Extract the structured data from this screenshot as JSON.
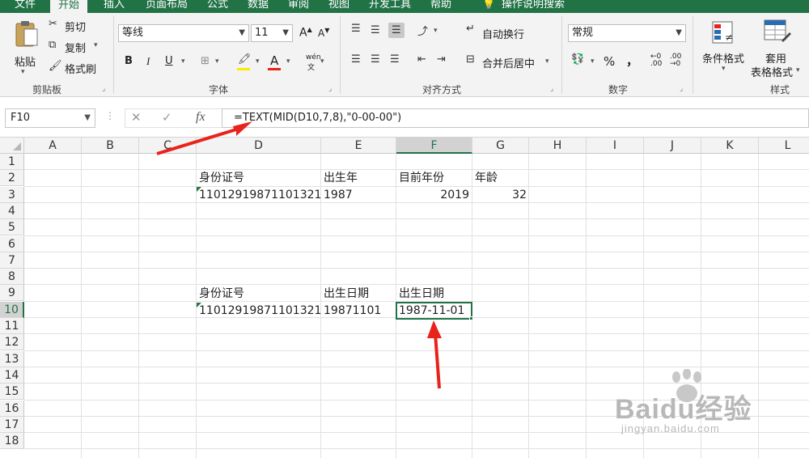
{
  "ribbon": {
    "tabs": [
      "文件",
      "开始",
      "插入",
      "页面布局",
      "公式",
      "数据",
      "审阅",
      "视图",
      "开发工具",
      "帮助",
      "操作说明搜索"
    ],
    "active_tab_index": 1,
    "clipboard": {
      "paste": "粘贴",
      "cut": "剪切",
      "copy": "复制",
      "format_painter": "格式刷",
      "label": "剪贴板"
    },
    "font": {
      "name": "等线",
      "size": "11",
      "grow": "A",
      "shrink": "A",
      "bold": "B",
      "italic": "I",
      "underline": "U",
      "color_letter": "A",
      "phonetic": "wén",
      "label": "字体"
    },
    "alignment": {
      "wrap_text": "自动换行",
      "merge_center": "合并后居中",
      "label": "对齐方式"
    },
    "number": {
      "format": "常规",
      "percent": "%",
      "comma": "，",
      "label": "数字"
    },
    "styles": {
      "conditional": "条件格式",
      "table_line1": "套用",
      "table_line2": "表格格式",
      "label": "样式"
    }
  },
  "formula_bar": {
    "name_box": "F10",
    "cancel": "✕",
    "enter": "✓",
    "fx": "fx",
    "formula": "=TEXT(MID(D10,7,8),\"0-00-00\")"
  },
  "sheet": {
    "columns": [
      "A",
      "B",
      "C",
      "D",
      "E",
      "F",
      "G",
      "H",
      "I",
      "J",
      "K",
      "L"
    ],
    "rows": [
      "1",
      "2",
      "3",
      "4",
      "5",
      "6",
      "7",
      "8",
      "9",
      "10",
      "11",
      "12",
      "13",
      "14",
      "15",
      "16",
      "17",
      "18"
    ],
    "selected_column": "F",
    "selected_row": "10",
    "cells": {
      "D2": "身份证号",
      "E2": "出生年",
      "F2": "目前年份",
      "G2": "年龄",
      "D3": "11012919871101321",
      "E3": "1987",
      "F3": "2019",
      "G3": "32",
      "D9": "身份证号",
      "E9": "出生日期",
      "F9": "出生日期",
      "D10": "11012919871101321",
      "E10": "19871101",
      "F10": "1987-11-01"
    }
  },
  "watermark": {
    "brand": "Baidu经验",
    "url": "jingyan.baidu.com"
  },
  "colors": {
    "excel_green": "#217346",
    "arrow_red": "#e8231b"
  }
}
